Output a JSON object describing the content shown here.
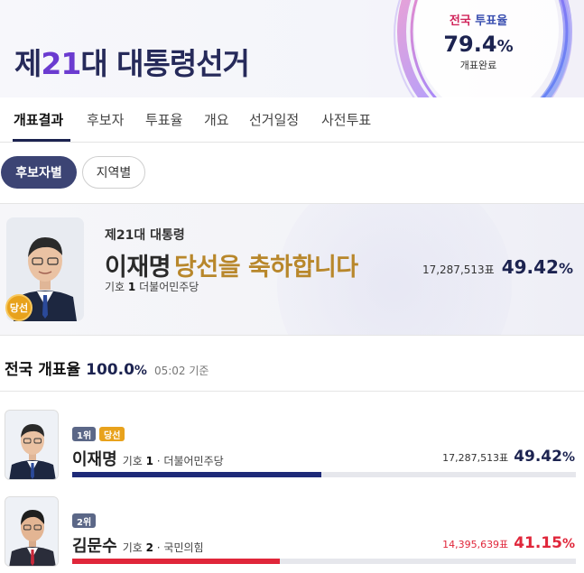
{
  "header": {
    "title_prefix": "제",
    "title_number": "21",
    "title_suffix": "대 대통령선거",
    "turnout_label_1": "전국",
    "turnout_label_2": "투표율",
    "turnout_value": "79.4",
    "turnout_unit": "%",
    "turnout_status": "개표완료"
  },
  "tabs": [
    {
      "label": "개표결과",
      "active": true
    },
    {
      "label": "후보자"
    },
    {
      "label": "투표율"
    },
    {
      "label": "개요"
    },
    {
      "label": "선거일정"
    },
    {
      "label": "사전투표"
    }
  ],
  "filters": {
    "by_candidate": "후보자별",
    "by_region": "지역별"
  },
  "winner": {
    "badge": "당선",
    "subtitle": "제21대 대통령",
    "name": "이재명",
    "congrats": "당선을 축하합니다",
    "number_label": "기호",
    "number": "1",
    "party": "더불어민주당",
    "votes": "17,287,513표",
    "percent": "49.42",
    "percent_unit": "%"
  },
  "nationwide": {
    "label": "전국 개표율",
    "value": "100.0",
    "unit": "%",
    "time": "05:02 기준"
  },
  "candidates": [
    {
      "rank": "1위",
      "elected": "당선",
      "name": "이재명",
      "number_label": "기호",
      "number": "1",
      "party": "· 더불어민주당",
      "votes": "17,287,513표",
      "percent": "49.42",
      "percent_unit": "%",
      "share": 0.4942,
      "color": "#1e2a78",
      "votes_color": "#333333",
      "pct_color": "#1c2350"
    },
    {
      "rank": "2위",
      "name": "김문수",
      "number_label": "기호",
      "number": "2",
      "party": "· 국민의힘",
      "votes": "14,395,639표",
      "percent": "41.15",
      "percent_unit": "%",
      "share": 0.4115,
      "color": "#e0263a",
      "votes_color": "#e0263a",
      "pct_color": "#e0263a"
    }
  ]
}
